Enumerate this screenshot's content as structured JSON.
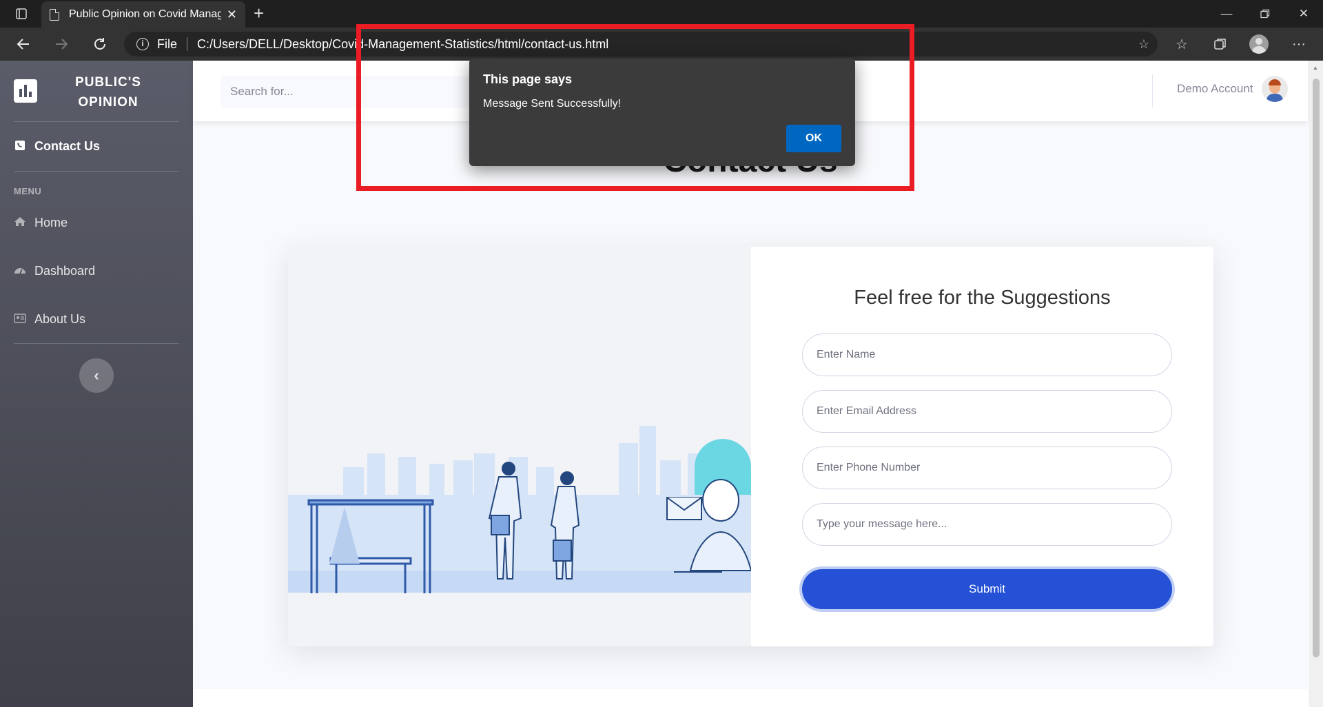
{
  "browser": {
    "tab_title": "Public Opinion on Covid Manage",
    "new_tab": "+",
    "url_scheme": "File",
    "url": "C:/Users/DELL/Desktop/Covid-Management-Statistics/html/contact-us.html"
  },
  "sidebar": {
    "brand_line1": "PUBLIC'S",
    "brand_line2": "OPINION",
    "active_item": "Contact Us",
    "menu_heading": "MENU",
    "items": [
      {
        "label": "Home",
        "icon": "home-icon"
      },
      {
        "label": "Dashboard",
        "icon": "tachometer-icon"
      },
      {
        "label": "About Us",
        "icon": "id-card-icon"
      }
    ],
    "toggle_glyph": "‹"
  },
  "topbar": {
    "search_placeholder": "Search for...",
    "account_name": "Demo Account"
  },
  "page": {
    "heading": "Contact Us"
  },
  "form": {
    "title": "Feel free for the Suggestions",
    "name_placeholder": "Enter Name",
    "email_placeholder": "Enter Email Address",
    "phone_placeholder": "Enter Phone Number",
    "message_placeholder": "Type your message here...",
    "submit_label": "Submit"
  },
  "dialog": {
    "title": "This page says",
    "message": "Message Sent Successfully!",
    "ok_label": "OK"
  },
  "colors": {
    "sidebar_top": "#5a5c69",
    "sidebar_bottom": "#3f4049",
    "submit_button": "#2451d6",
    "dialog_ok": "#0067c0",
    "highlight": "#ea1c24"
  }
}
